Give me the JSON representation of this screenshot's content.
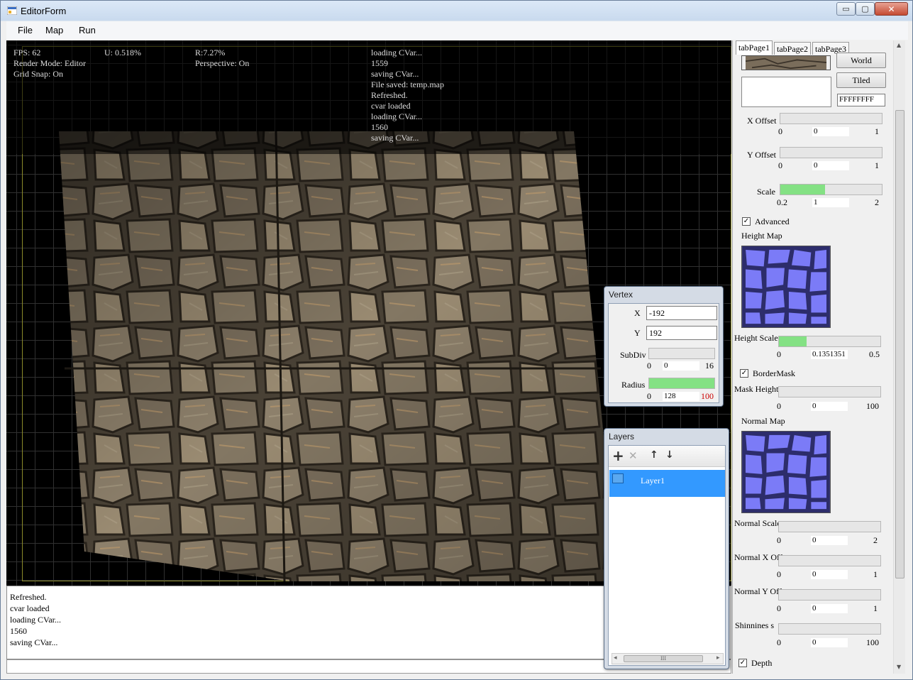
{
  "window": {
    "title": "EditorForm",
    "controls": {
      "minimize": "▭",
      "maximize": "▢",
      "close": "✕"
    }
  },
  "menu": {
    "items": [
      "File",
      "Map",
      "Run"
    ]
  },
  "hud": {
    "fps": "FPS: 62",
    "render_mode": "Render Mode: Editor",
    "grid_snap": "Grid Snap: On",
    "u": "U: 0.518%",
    "r": "R:7.27%",
    "perspective": "Perspective: On",
    "log": [
      "loading CVar...",
      "1559",
      "saving CVar...",
      "File saved: temp.map",
      "Refreshed.",
      "cvar loaded",
      "loading CVar...",
      "1560",
      "saving CVar..."
    ]
  },
  "console": {
    "lines": [
      "Refreshed.",
      "cvar loaded",
      "loading CVar...",
      "1560",
      "saving CVar..."
    ],
    "input": ""
  },
  "vertex": {
    "title": "Vertex",
    "x_label": "X",
    "x_value": "-192",
    "y_label": "Y",
    "y_value": "192",
    "subdiv_label": "SubDiv",
    "subdiv_min": "0",
    "subdiv_value": "0",
    "subdiv_max": "16",
    "subdiv_level": 0,
    "radius_label": "Radius",
    "radius_min": "0",
    "radius_value": "128",
    "radius_max": "100",
    "radius_level": 1.0
  },
  "layers": {
    "title": "Layers",
    "toolbar": {
      "add": "+",
      "delete": "✕",
      "up": "↑",
      "down": "↓"
    },
    "items": [
      "Layer1"
    ],
    "scroll_grip": "III"
  },
  "rpanel": {
    "tabs": [
      "tabPage1",
      "tabPage2",
      "tabPage3"
    ],
    "world_button": "World",
    "tiled_button": "Tiled",
    "color_value": "FFFFFFFF",
    "x_offset": {
      "label": "X Offset",
      "min": "0",
      "value": "0",
      "max": "1",
      "level": 0
    },
    "y_offset": {
      "label": "Y Offset",
      "min": "0",
      "value": "0",
      "max": "1",
      "level": 0
    },
    "scale": {
      "label": "Scale",
      "min": "0.2",
      "value": "1",
      "max": "2",
      "level": 0.44
    },
    "advanced": {
      "label": "Advanced",
      "checked": "✓"
    },
    "height_map_label": "Height Map",
    "height_scale": {
      "label": "Height Scale",
      "min": "0",
      "value": "0.1351351",
      "max": "0.5",
      "level": 0.27
    },
    "border_mask": {
      "label": "BorderMask",
      "checked": "✓"
    },
    "mask_height": {
      "label": "Mask Height",
      "min": "0",
      "value": "0",
      "max": "100",
      "level": 0
    },
    "normal_map_label": "Normal Map",
    "normal_scale": {
      "label": "Normal Scale",
      "min": "0",
      "value": "0",
      "max": "2",
      "level": 0
    },
    "normal_x_offset": {
      "label": "Normal X Offset",
      "min": "0",
      "value": "0",
      "max": "1",
      "level": 0
    },
    "normal_y_offset": {
      "label": "Normal Y Offset",
      "min": "0",
      "value": "0",
      "max": "1",
      "level": 0
    },
    "shininess": {
      "label": "Shinnines s",
      "min": "0",
      "value": "0",
      "max": "100",
      "level": 0
    },
    "depth": {
      "label": "Depth",
      "checked": "✓"
    }
  },
  "colors": {
    "selection": "#3399ff",
    "slider_fill": "#84e184",
    "height_map": "#7b7bf7",
    "radius_max": "#cc0000"
  }
}
